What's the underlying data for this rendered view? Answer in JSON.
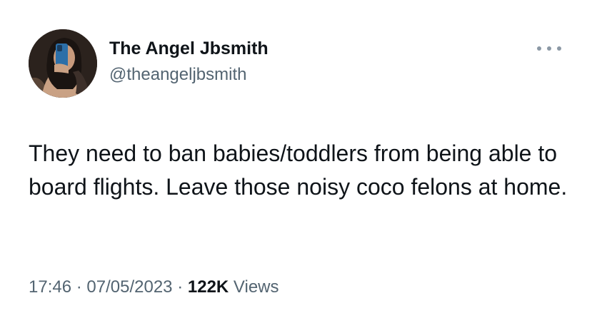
{
  "author": {
    "display_name": "The Angel Jbsmith",
    "handle": "@theangeljbsmith",
    "avatar_icon": "profile-photo"
  },
  "more_menu": {
    "icon": "more-horizontal-icon"
  },
  "tweet": {
    "text": "They need to ban babies/toddlers from being able to board flights. Leave those noisy coco felons at home."
  },
  "meta": {
    "time": "17:46",
    "separator": "·",
    "date": "07/05/2023",
    "views_count": "122K",
    "views_label": "Views"
  },
  "colors": {
    "text_primary": "#0f1419",
    "text_secondary": "#536471",
    "background": "#ffffff"
  }
}
